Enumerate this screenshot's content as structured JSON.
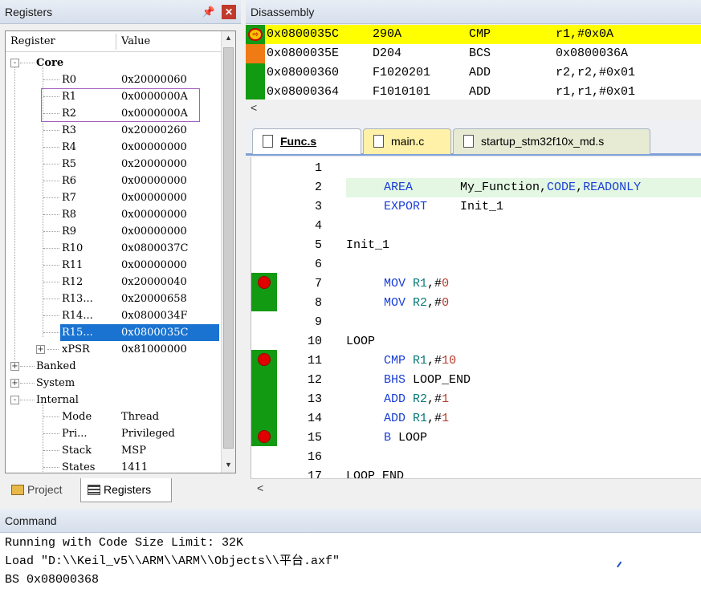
{
  "registers_panel": {
    "title": "Registers",
    "pin_icon": "pin-icon",
    "close_icon": "close-icon",
    "columns": {
      "register": "Register",
      "value": "Value"
    },
    "groups": {
      "core": "Core",
      "banked": "Banked",
      "system": "System",
      "internal": "Internal"
    },
    "core_rows": [
      {
        "name": "R0",
        "value": "0x20000060"
      },
      {
        "name": "R1",
        "value": "0x0000000A"
      },
      {
        "name": "R2",
        "value": "0x0000000A"
      },
      {
        "name": "R3",
        "value": "0x20000260"
      },
      {
        "name": "R4",
        "value": "0x00000000"
      },
      {
        "name": "R5",
        "value": "0x20000000"
      },
      {
        "name": "R6",
        "value": "0x00000000"
      },
      {
        "name": "R7",
        "value": "0x00000000"
      },
      {
        "name": "R8",
        "value": "0x00000000"
      },
      {
        "name": "R9",
        "value": "0x00000000"
      },
      {
        "name": "R10",
        "value": "0x0800037C"
      },
      {
        "name": "R11",
        "value": "0x00000000"
      },
      {
        "name": "R12",
        "value": "0x20000040"
      },
      {
        "name": "R13...",
        "value": "0x20000658"
      },
      {
        "name": "R14...",
        "value": "0x0800034F"
      },
      {
        "name": "R15...",
        "value": "0x0800035C"
      },
      {
        "name": "xPSR",
        "value": "0x81000000"
      }
    ],
    "internal_rows": [
      {
        "name": "Mode",
        "value": "Thread"
      },
      {
        "name": "Pri...",
        "value": "Privileged"
      },
      {
        "name": "Stack",
        "value": "MSP"
      },
      {
        "name": "States",
        "value": "1411"
      }
    ],
    "tabs": {
      "project": "Project",
      "registers": "Registers"
    }
  },
  "disassembly": {
    "title": "Disassembly",
    "lines": [
      {
        "addr": "0x0800035C",
        "code": "290A",
        "mnem": "CMP",
        "ops": "r1,#0x0A"
      },
      {
        "addr": "0x0800035E",
        "code": "D204",
        "mnem": "BCS",
        "ops": "0x0800036A"
      },
      {
        "addr": "0x08000360",
        "code": "F1020201",
        "mnem": "ADD",
        "ops": "r2,r2,#0x01"
      },
      {
        "addr": "0x08000364",
        "code": "F1010101",
        "mnem": "ADD",
        "ops": "r1,r1,#0x01"
      }
    ],
    "scroll_left": "<"
  },
  "editor": {
    "tabs": [
      {
        "label": "Func.s"
      },
      {
        "label": "main.c"
      },
      {
        "label": "startup_stm32f10x_md.s"
      }
    ],
    "line_numbers": [
      "1",
      "2",
      "3",
      "4",
      "5",
      "6",
      "7",
      "8",
      "9",
      "10",
      "11",
      "12",
      "13",
      "14",
      "15",
      "16",
      "17"
    ],
    "code": {
      "l2a": "AREA",
      "l2b": "My_Function",
      "l2c": ",",
      "l2d": "CODE",
      "l2e": ",",
      "l2f": "READONLY",
      "l3a": "EXPORT",
      "l3b": "Init_1",
      "l5": "Init_1",
      "l7a": "MOV",
      "l7b": "R1",
      "l7c": ",#",
      "l7d": "0",
      "l8a": "MOV",
      "l8b": "R2",
      "l8c": ",#",
      "l8d": "0",
      "l10": "LOOP",
      "l11a": "CMP",
      "l11b": "R1",
      "l11c": ",#",
      "l11d": "10",
      "l12a": "BHS",
      "l12b": "LOOP_END",
      "l13a": "ADD",
      "l13b": "R2",
      "l13c": ",#",
      "l13d": "1",
      "l14a": "ADD",
      "l14b": "R1",
      "l14c": ",#",
      "l14d": "1",
      "l15a": "B",
      "l15b": "LOOP",
      "l17": "LOOP_END"
    },
    "scroll_left": "<"
  },
  "command": {
    "title": "Command",
    "lines": [
      "Running with Code Size Limit: 32K",
      "Load \"D:\\\\Keil_v5\\\\ARM\\\\ARM\\\\Objects\\\\平台.axf\"",
      "BS 0x08000368"
    ]
  },
  "colors": {
    "current_line": "#ffff00",
    "breakpoint": "#e00000",
    "coverage": "#139a13",
    "selection": "#1a73d1"
  }
}
